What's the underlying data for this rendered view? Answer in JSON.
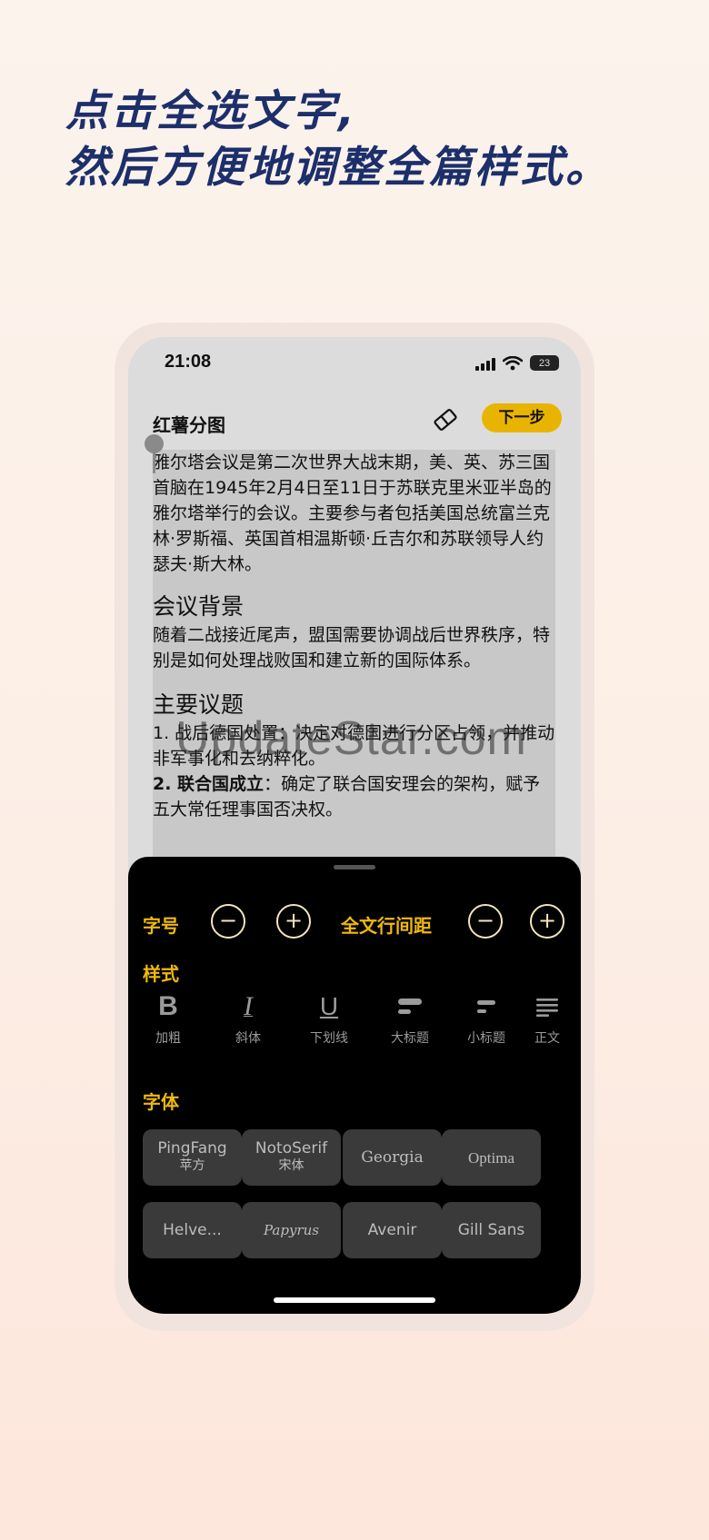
{
  "headline": {
    "line1": "点击全选文字,",
    "line2": "然后方便地调整全篇样式。"
  },
  "status_bar": {
    "time": "21:08",
    "battery": "23"
  },
  "topbar": {
    "title": "红薯分图",
    "next_label": "下一步"
  },
  "document": {
    "para1": "雅尔塔会议是第二次世界大战末期，美、英、苏三国首脑在1945年2月4日至11日于苏联克里米亚半岛的雅尔塔举行的会议。主要参与者包括美国总统富兰克林·罗斯福、英国首相温斯顿·丘吉尔和苏联领导人约瑟夫·斯大林。",
    "heading_background": "会议背景",
    "para2": "随着二战接近尾声，盟国需要协调战后世界秩序，特别是如何处理战败国和建立新的国际体系。",
    "heading_issues": "主要议题",
    "item1": "1.  战后德国处置：决定对德国进行分区占领，并推动非军事化和去纳粹化。",
    "item2_bold": "2. 联合国成立",
    "item2_rest": "：确定了联合国安理会的架构，赋予五大常任理事国否决权。"
  },
  "watermark": "UpdateStar.com",
  "panel": {
    "font_size_label": "字号",
    "line_spacing_label": "全文行间距",
    "minus_symbol": "−",
    "plus_symbol": "+",
    "style_label": "样式",
    "styles": [
      {
        "icon": "bold-icon",
        "label": "加粗"
      },
      {
        "icon": "italic-icon",
        "label": "斜体"
      },
      {
        "icon": "underline-icon",
        "label": "下划线"
      },
      {
        "icon": "large-heading-icon",
        "label": "大标题"
      },
      {
        "icon": "small-heading-icon",
        "label": "小标题"
      },
      {
        "icon": "body-text-icon",
        "label": "正文"
      }
    ],
    "font_label": "字体",
    "fonts": [
      {
        "name": "PingFang",
        "sub": "苹方"
      },
      {
        "name": "NotoSerif",
        "sub": "宋体"
      },
      {
        "name": "Georgia",
        "sub": ""
      },
      {
        "name": "Optima",
        "sub": ""
      },
      {
        "name": "Helve...",
        "sub": ""
      },
      {
        "name": "Papyrus",
        "sub": ""
      },
      {
        "name": "Avenir",
        "sub": ""
      },
      {
        "name": "Gill Sans",
        "sub": ""
      }
    ]
  },
  "colors": {
    "accent": "#f0b90b",
    "next_button": "#e9b400",
    "headline": "#1d2f6b",
    "panel_bg": "#000000"
  }
}
